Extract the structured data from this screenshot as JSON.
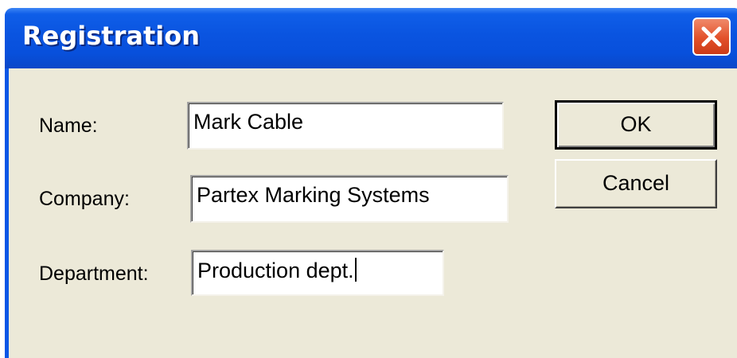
{
  "window": {
    "title": "Registration"
  },
  "form": {
    "name": {
      "label": "Name:",
      "value": "Mark Cable"
    },
    "company": {
      "label": "Company:",
      "value": "Partex Marking Systems"
    },
    "department": {
      "label": "Department:",
      "value": "Production dept."
    }
  },
  "buttons": {
    "ok_label": "OK",
    "cancel_label": "Cancel"
  },
  "icons": {
    "close": "close-icon"
  },
  "colors": {
    "titlebar": "#0a54e0",
    "close_button": "#e2502a",
    "dialog_background": "#ece9d8"
  }
}
